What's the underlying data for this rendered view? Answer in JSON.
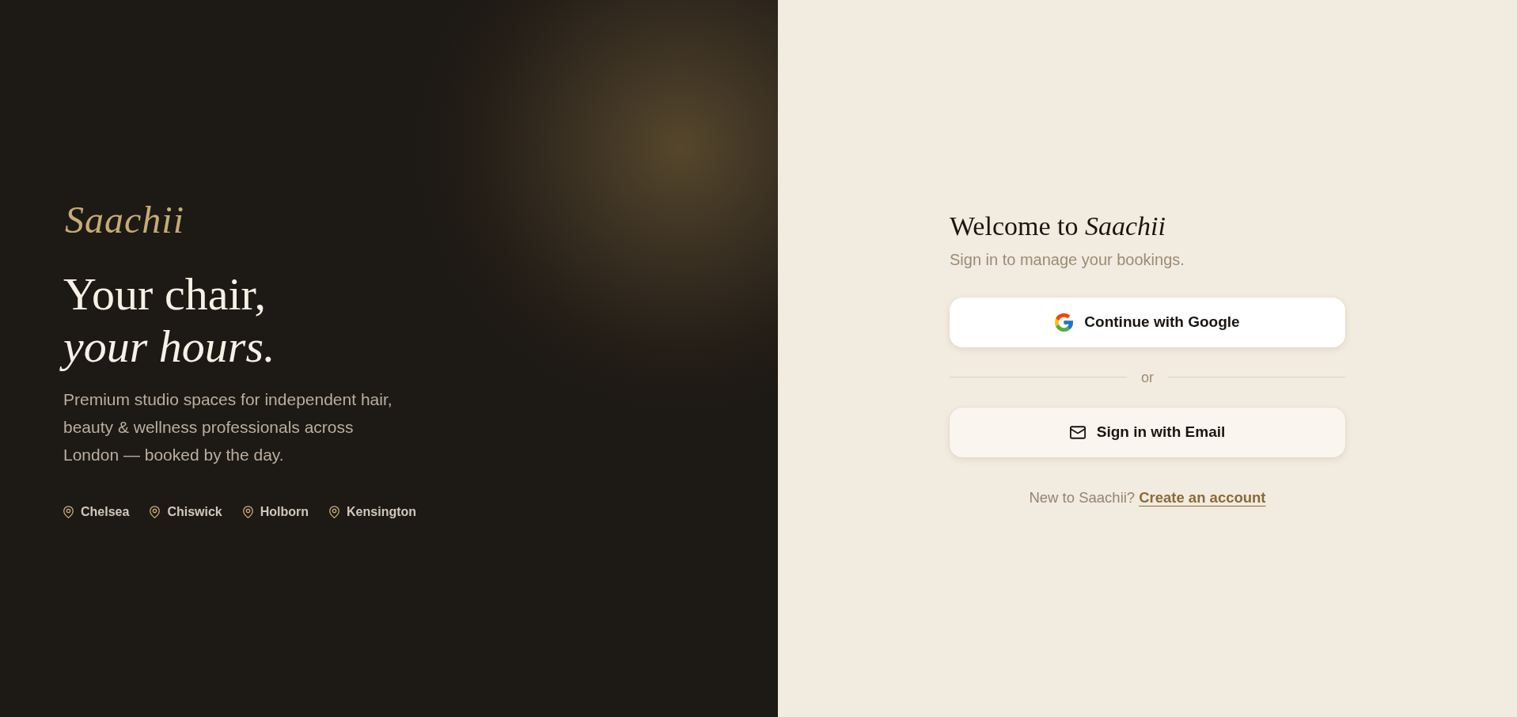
{
  "brand": {
    "logo": "Saachii"
  },
  "hero": {
    "headline": "Your chair, *your hours.*",
    "description": "Premium studio spaces for independent hair, beauty & wellness professionals across London — booked by the day.",
    "locations": [
      "Chelsea",
      "Chiswick",
      "Holborn",
      "Kensington"
    ]
  },
  "sign_in": {
    "title": "Welcome to *Saachii*",
    "subtitle": "Sign in to manage your bookings.",
    "options": [
      {
        "kind": "google",
        "label": "Continue with Google"
      },
      {
        "kind": "divider",
        "label": "or"
      },
      {
        "kind": "email",
        "label": "Sign in with Email"
      }
    ],
    "footer": {
      "text": "New to Saachii?",
      "link": "Create an account"
    }
  }
}
